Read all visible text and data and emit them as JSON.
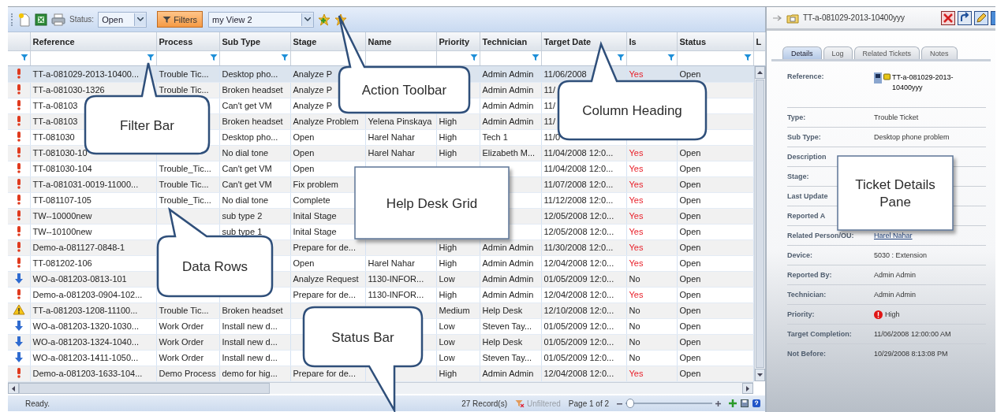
{
  "toolbar": {
    "status_label": "Status:",
    "status_value": "Open",
    "filters": {
      "label": "Filters",
      "on": true
    },
    "view": "my View 2"
  },
  "grid": {
    "columns": [
      "Reference",
      "Process",
      "Sub Type",
      "Stage",
      "Name",
      "Priority",
      "Technician",
      "Target Date",
      "Is",
      "Status",
      "L"
    ],
    "rows": [
      {
        "kind": "high",
        "selected": true,
        "overdue": true,
        "cells": [
          "TT-a-081029-2013-10400...",
          "Trouble Tic...",
          "Desktop pho...",
          "Analyze P",
          null,
          null,
          "Admin Admin",
          "11/06/2008",
          "Yes",
          "Open"
        ]
      },
      {
        "kind": "high",
        "selected": false,
        "cells": [
          "TT-a-081030-1326",
          "Trouble Tic...",
          "Broken headset",
          "Analyze P",
          null,
          null,
          "Admin Admin",
          "11/",
          null,
          null
        ]
      },
      {
        "kind": "high",
        "selected": false,
        "cells": [
          "TT-a-08103",
          null,
          "Can't get VM",
          "Analyze P",
          null,
          null,
          "Admin Admin",
          "11/",
          null,
          null
        ]
      },
      {
        "kind": "high",
        "selected": false,
        "cells": [
          "TT-a-08103",
          null,
          "Broken headset",
          "Analyze Problem",
          "Yelena Pinskaya",
          "High",
          "Admin Admin",
          "11/",
          null,
          null
        ]
      },
      {
        "kind": "high",
        "selected": false,
        "cells": [
          "TT-081030",
          null,
          "Desktop pho...",
          "Open",
          "Harel Nahar",
          "High",
          "Tech 1",
          "11/0",
          null,
          null
        ]
      },
      {
        "kind": "high",
        "selected": false,
        "overdue": true,
        "cells": [
          "TT-081030-10",
          null,
          "No dial tone",
          "Open",
          "Harel Nahar",
          "High",
          "Elizabeth M...",
          "11/04/2008 12:0...",
          "Yes",
          "Open"
        ]
      },
      {
        "kind": "high",
        "selected": false,
        "overdue": true,
        "cells": [
          "TT-081030-104",
          "Trouble_Tic...",
          "Can't get VM",
          "Open",
          null,
          null,
          null,
          "11/04/2008 12:0...",
          "Yes",
          "Open"
        ]
      },
      {
        "kind": "high",
        "selected": false,
        "overdue": true,
        "cells": [
          "TT-a-081031-0019-11000...",
          "Trouble Tic...",
          "Can't get VM",
          "Fix problem",
          null,
          null,
          null,
          "11/07/2008 12:0...",
          "Yes",
          "Open"
        ]
      },
      {
        "kind": "high",
        "selected": false,
        "overdue": true,
        "cells": [
          "TT-081107-105",
          "Trouble_Tic...",
          "No dial tone",
          "Complete",
          null,
          null,
          null,
          "11/12/2008 12:0...",
          "Yes",
          "Open"
        ]
      },
      {
        "kind": "high",
        "selected": false,
        "overdue": true,
        "cells": [
          "TW--10000new",
          null,
          "sub type 2",
          "Inital Stage",
          null,
          null,
          null,
          "12/05/2008 12:0...",
          "Yes",
          "Open"
        ]
      },
      {
        "kind": "high",
        "selected": false,
        "overdue": true,
        "cells": [
          "TW--10100new",
          null,
          "sub type 1",
          "Inital Stage",
          null,
          null,
          null,
          "12/05/2008 12:0...",
          "Yes",
          "Open"
        ]
      },
      {
        "kind": "high",
        "selected": false,
        "overdue": true,
        "cells": [
          "Demo-a-081127-0848-1",
          null,
          null,
          "Prepare for de...",
          null,
          "High",
          "Admin Admin",
          "11/30/2008 12:0...",
          "Yes",
          "Open"
        ]
      },
      {
        "kind": "high",
        "selected": false,
        "overdue": true,
        "cells": [
          "TT-081202-106",
          null,
          null,
          "Open",
          "Harel Nahar",
          "High",
          "Admin Admin",
          "12/04/2008 12:0...",
          "Yes",
          "Open"
        ]
      },
      {
        "kind": "low",
        "selected": false,
        "overdue": false,
        "cells": [
          "WO-a-081203-0813-101",
          null,
          null,
          "Analyze Request",
          "1130-INFOR...",
          "Low",
          "Admin Admin",
          "01/05/2009 12:0...",
          "No",
          "Open"
        ]
      },
      {
        "kind": "high",
        "selected": false,
        "overdue": true,
        "cells": [
          "Demo-a-081203-0904-102...",
          null,
          null,
          "Prepare for de...",
          "1130-INFOR...",
          "High",
          "Admin Admin",
          "12/04/2008 12:0...",
          "Yes",
          "Open"
        ]
      },
      {
        "kind": "warning",
        "selected": false,
        "overdue": false,
        "cells": [
          "TT-a-081203-1208-11100...",
          "Trouble Tic...",
          "Broken headset",
          null,
          null,
          "Medium",
          "Help Desk",
          "12/10/2008 12:0...",
          "No",
          "Open"
        ]
      },
      {
        "kind": "low",
        "selected": false,
        "overdue": false,
        "cells": [
          "WO-a-081203-1320-1030...",
          "Work Order",
          "Install new d...",
          null,
          null,
          "Low",
          "Steven Tay...",
          "01/05/2009 12:0...",
          "No",
          "Open"
        ]
      },
      {
        "kind": "low",
        "selected": false,
        "overdue": false,
        "cells": [
          "WO-a-081203-1324-1040...",
          "Work Order",
          "Install new d...",
          null,
          null,
          "Low",
          "Help Desk",
          "01/05/2009 12:0...",
          "No",
          "Open"
        ]
      },
      {
        "kind": "low",
        "selected": false,
        "overdue": false,
        "cells": [
          "WO-a-081203-1411-1050...",
          "Work Order",
          "Install new d...",
          null,
          null,
          "Low",
          "Steven Tay...",
          "01/05/2009 12:0...",
          "No",
          "Open"
        ]
      },
      {
        "kind": "high",
        "selected": false,
        "overdue": true,
        "cells": [
          "Demo-a-081203-1633-104...",
          "Demo Process",
          "demo for hig...",
          "Prepare for de...",
          null,
          "High",
          "Admin Admin",
          "12/04/2008 12:0...",
          "Yes",
          "Open"
        ]
      }
    ]
  },
  "status_bar": {
    "message": "Ready.",
    "records": "27 Record(s)",
    "filter_state": "Unfiltered",
    "page": "Page 1 of 2",
    "zoom": {
      "level": 0.05
    }
  },
  "details": {
    "title": "TT-a-081029-2013-10400yyy",
    "tabs": [
      {
        "label": "Details",
        "selected": true
      },
      {
        "label": "Log",
        "selected": false
      },
      {
        "label": "Related Tickets",
        "selected": false
      },
      {
        "label": "Notes",
        "selected": false
      }
    ],
    "fields": [
      {
        "label": "Reference:",
        "kind": "reference",
        "value": "TT-a-081029-2013-10400yyy"
      },
      {
        "label": "Type:",
        "kind": "text",
        "value": "Trouble Ticket"
      },
      {
        "label": "Sub Type:",
        "kind": "text",
        "value": "Desktop phone problem"
      },
      {
        "label": "Description",
        "kind": "text"
      },
      {
        "label": "Stage:",
        "kind": "text"
      },
      {
        "label": "Last Update",
        "kind": "text"
      },
      {
        "label": "Reported A",
        "kind": "text"
      },
      {
        "label": "Related Person/OU:",
        "kind": "link",
        "value": "Harel Nahar"
      },
      {
        "label": "Device:",
        "kind": "text",
        "value": "5030 : Extension"
      },
      {
        "label": "Reported By:",
        "kind": "text",
        "value": "Admin Admin"
      },
      {
        "label": "Technician:",
        "kind": "text",
        "value": "Admin Admin"
      },
      {
        "label": "Priority:",
        "kind": "priority",
        "value": "High"
      },
      {
        "label": "Target Completion:",
        "kind": "text",
        "value": "11/06/2008 12:00:00 AM"
      },
      {
        "label": "Not Before:",
        "kind": "text",
        "value": "10/29/2008 8:13:08 PM"
      }
    ]
  },
  "callouts": [
    {
      "kind": "bubble",
      "lines": [
        "Action Toolbar"
      ]
    },
    {
      "kind": "bubble",
      "lines": [
        "Filter Bar"
      ]
    },
    {
      "kind": "bubble",
      "lines": [
        "Column Heading"
      ]
    },
    {
      "kind": "box",
      "lines": [
        "Help Desk Grid"
      ]
    },
    {
      "kind": "bubble",
      "lines": [
        "Data Rows"
      ]
    },
    {
      "kind": "bubble",
      "lines": [
        "Status Bar"
      ]
    },
    {
      "kind": "box",
      "lines": [
        "Ticket Details",
        "Pane"
      ]
    }
  ]
}
